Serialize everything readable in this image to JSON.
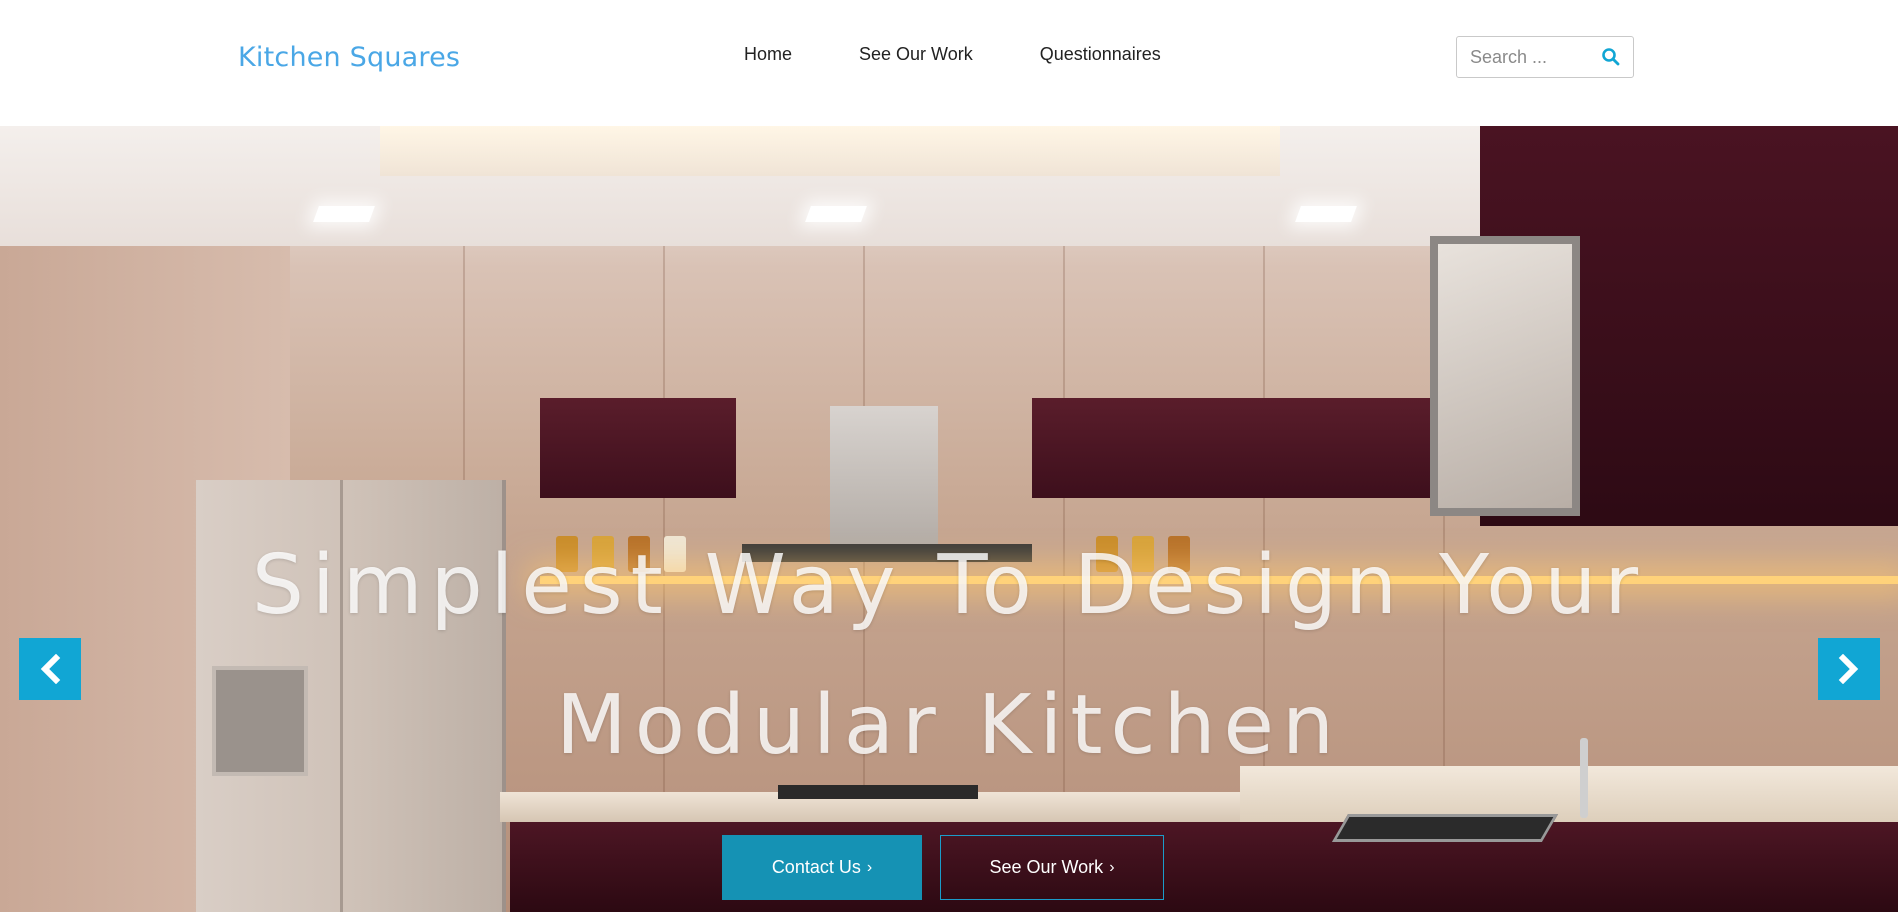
{
  "header": {
    "brand": "Kitchen Squares",
    "nav": [
      {
        "label": "Home"
      },
      {
        "label": "See Our Work"
      },
      {
        "label": "Questionnaires"
      }
    ],
    "search": {
      "placeholder": "Search ...",
      "value": "",
      "icon": "search-icon"
    }
  },
  "hero": {
    "title_line1": "Simplest Way To Design Your",
    "title_line2": "Modular Kitchen",
    "prev_icon": "chevron-left-icon",
    "next_icon": "chevron-right-icon",
    "buttons": {
      "contact_label": "Contact Us",
      "work_label": "See Our Work",
      "chevron": "›"
    }
  },
  "colors": {
    "brand": "#4aa7e6",
    "accent": "#11a6d4",
    "contact_button": "#1592b4"
  }
}
